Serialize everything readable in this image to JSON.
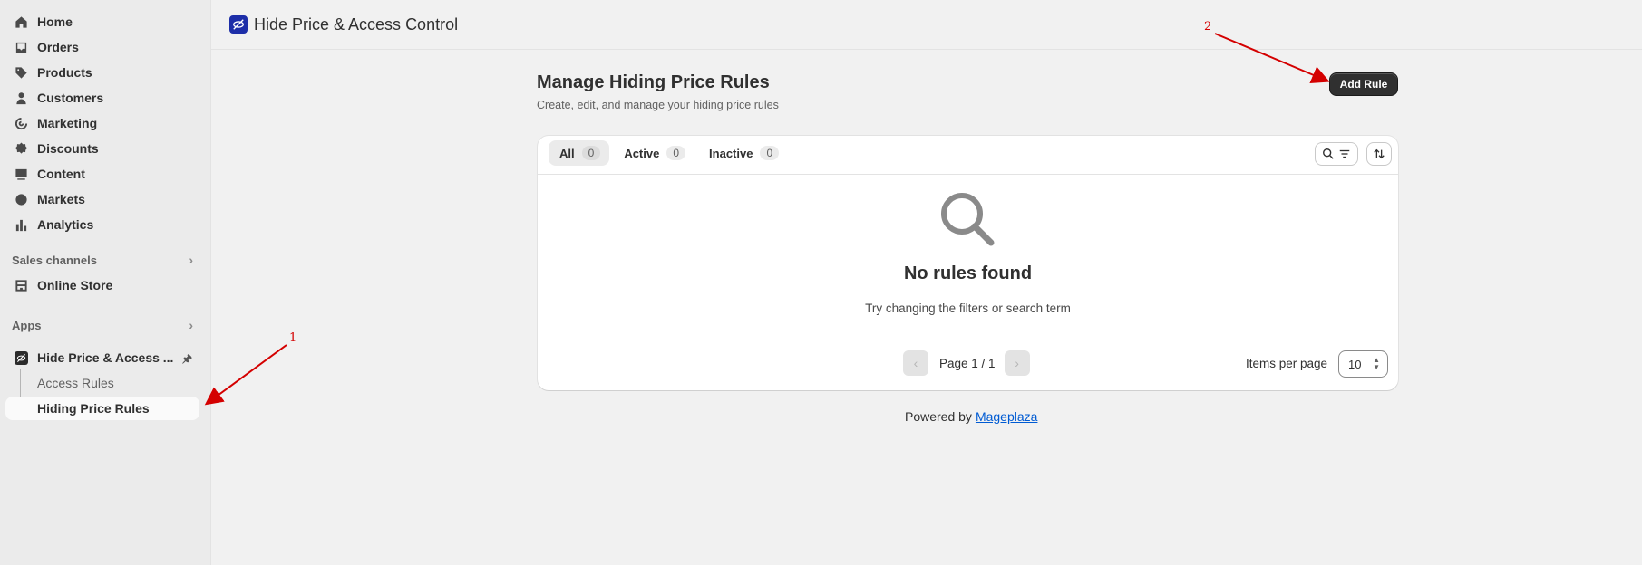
{
  "sidebar": {
    "items": [
      {
        "label": "Home",
        "icon": "home-icon"
      },
      {
        "label": "Orders",
        "icon": "inbox-icon"
      },
      {
        "label": "Products",
        "icon": "tag-icon"
      },
      {
        "label": "Customers",
        "icon": "person-icon"
      },
      {
        "label": "Marketing",
        "icon": "target-icon"
      },
      {
        "label": "Discounts",
        "icon": "discount-icon"
      },
      {
        "label": "Content",
        "icon": "image-icon"
      },
      {
        "label": "Markets",
        "icon": "globe-icon"
      },
      {
        "label": "Analytics",
        "icon": "bar-chart-icon"
      }
    ],
    "sales_channels": {
      "label": "Sales channels",
      "items": [
        {
          "label": "Online Store",
          "icon": "store-icon"
        }
      ]
    },
    "apps": {
      "label": "Apps",
      "app_name": "Hide Price & Access ...",
      "sub_items": [
        {
          "label": "Access Rules"
        },
        {
          "label": "Hiding Price Rules"
        }
      ]
    }
  },
  "topbar": {
    "title": "Hide Price & Access Control",
    "accent": "#1d2ea8"
  },
  "main": {
    "title": "Manage Hiding Price Rules",
    "subtitle": "Create, edit, and manage your hiding price rules",
    "add_button": "Add Rule",
    "tabs": [
      {
        "label": "All",
        "count": "0"
      },
      {
        "label": "Active",
        "count": "0"
      },
      {
        "label": "Inactive",
        "count": "0"
      }
    ],
    "empty_title": "No rules found",
    "empty_subtitle": "Try changing the filters or search term",
    "pager_text": "Page 1 / 1",
    "items_per_page_label": "Items per page",
    "items_per_page_value": "10"
  },
  "footer": {
    "powered_by": "Powered by",
    "link": "Mageplaza",
    "link_color": "#005bd3"
  },
  "annotations": {
    "label_1": "1",
    "label_2": "2",
    "color": "#d40000"
  }
}
